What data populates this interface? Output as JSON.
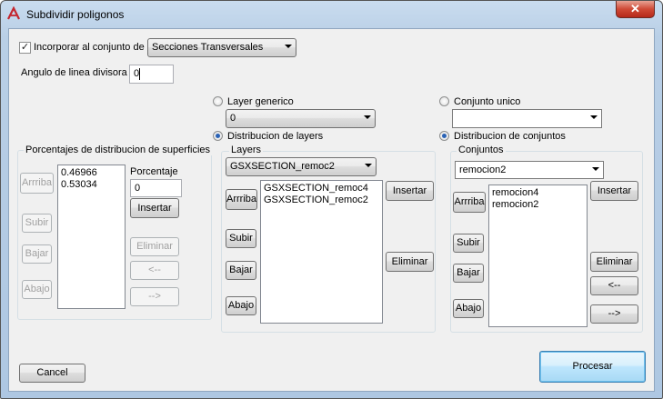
{
  "window": {
    "title": "Subdividir poligonos",
    "close_glyph": "✕"
  },
  "incorporar": {
    "label": "Incorporar al conjunto de",
    "checked": true,
    "value": "Secciones Transversales"
  },
  "angulo": {
    "label": "Angulo de linea divisora",
    "value": "0"
  },
  "left_group": {
    "title": "Porcentajes de distribucion de superficies",
    "items": [
      "0.46966",
      "0.53034"
    ],
    "arriba": "Arrriba",
    "subir": "Subir",
    "bajar": "Bajar",
    "abajo": "Abajo",
    "porcentaje_label": "Porcentaje",
    "porcentaje_value": "0",
    "insertar": "Insertar",
    "eliminar": "Eliminar",
    "left": "<--",
    "right": "-->"
  },
  "layer_mode": {
    "generico_label": "Layer generico",
    "generico_value": "0",
    "distribucion_label": "Distribucion de layers",
    "selected": "distribucion"
  },
  "layers_group": {
    "title": "Layers",
    "combo_value": "GSXSECTION_remoc2",
    "items": [
      "GSXSECTION_remoc4",
      "GSXSECTION_remoc2"
    ],
    "arriba": "Arrriba",
    "subir": "Subir",
    "bajar": "Bajar",
    "abajo": "Abajo",
    "insertar": "Insertar",
    "eliminar": "Eliminar"
  },
  "conjunto_mode": {
    "unico_label": "Conjunto unico",
    "unico_value": "",
    "distribucion_label": "Distribucion de conjuntos",
    "selected": "distribucion"
  },
  "conjuntos_group": {
    "title": "Conjuntos",
    "combo_value": "remocion2",
    "items": [
      "remocion4",
      "remocion2"
    ],
    "arriba": "Arrriba",
    "subir": "Subir",
    "bajar": "Bajar",
    "abajo": "Abajo",
    "insertar": "Insertar",
    "eliminar": "Eliminar",
    "left": "<--",
    "right": "-->"
  },
  "footer": {
    "cancel": "Cancel",
    "procesar": "Procesar"
  },
  "colors": {
    "accent": "#2a62b5",
    "close": "#cf4a36"
  }
}
